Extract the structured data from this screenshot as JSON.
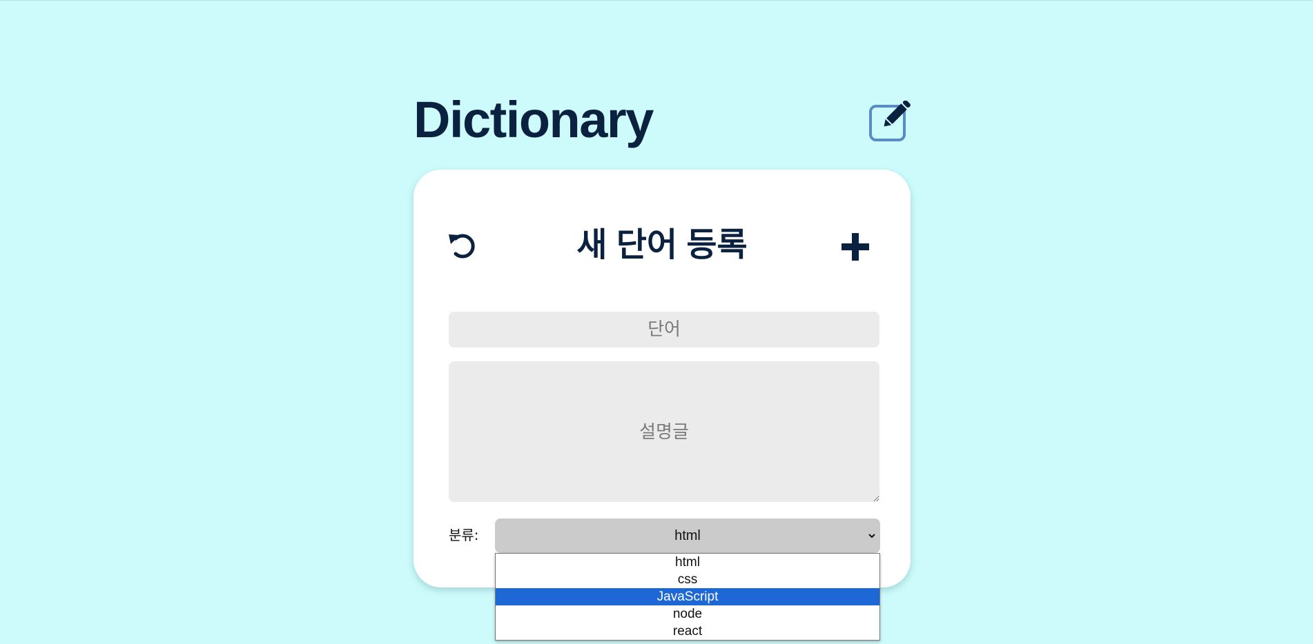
{
  "header": {
    "title": "Dictionary",
    "edit_icon": "edit-square-icon"
  },
  "card": {
    "title": "새 단어 등록",
    "reset_icon": "undo-icon",
    "add_icon": "plus-icon",
    "word_placeholder": "단어",
    "description_placeholder": "설명글",
    "category_label": "분류:",
    "category_selected": "html"
  },
  "dropdown": {
    "options": [
      "html",
      "css",
      "JavaScript",
      "node",
      "react"
    ],
    "highlighted": "JavaScript"
  },
  "colors": {
    "background": "#cdfbfb",
    "text_dark": "#0b2140",
    "input_bg": "#ebebeb",
    "select_bg": "#cbcbcb",
    "highlight": "#1d68d6",
    "edit_icon_border": "#5a8ac7"
  }
}
